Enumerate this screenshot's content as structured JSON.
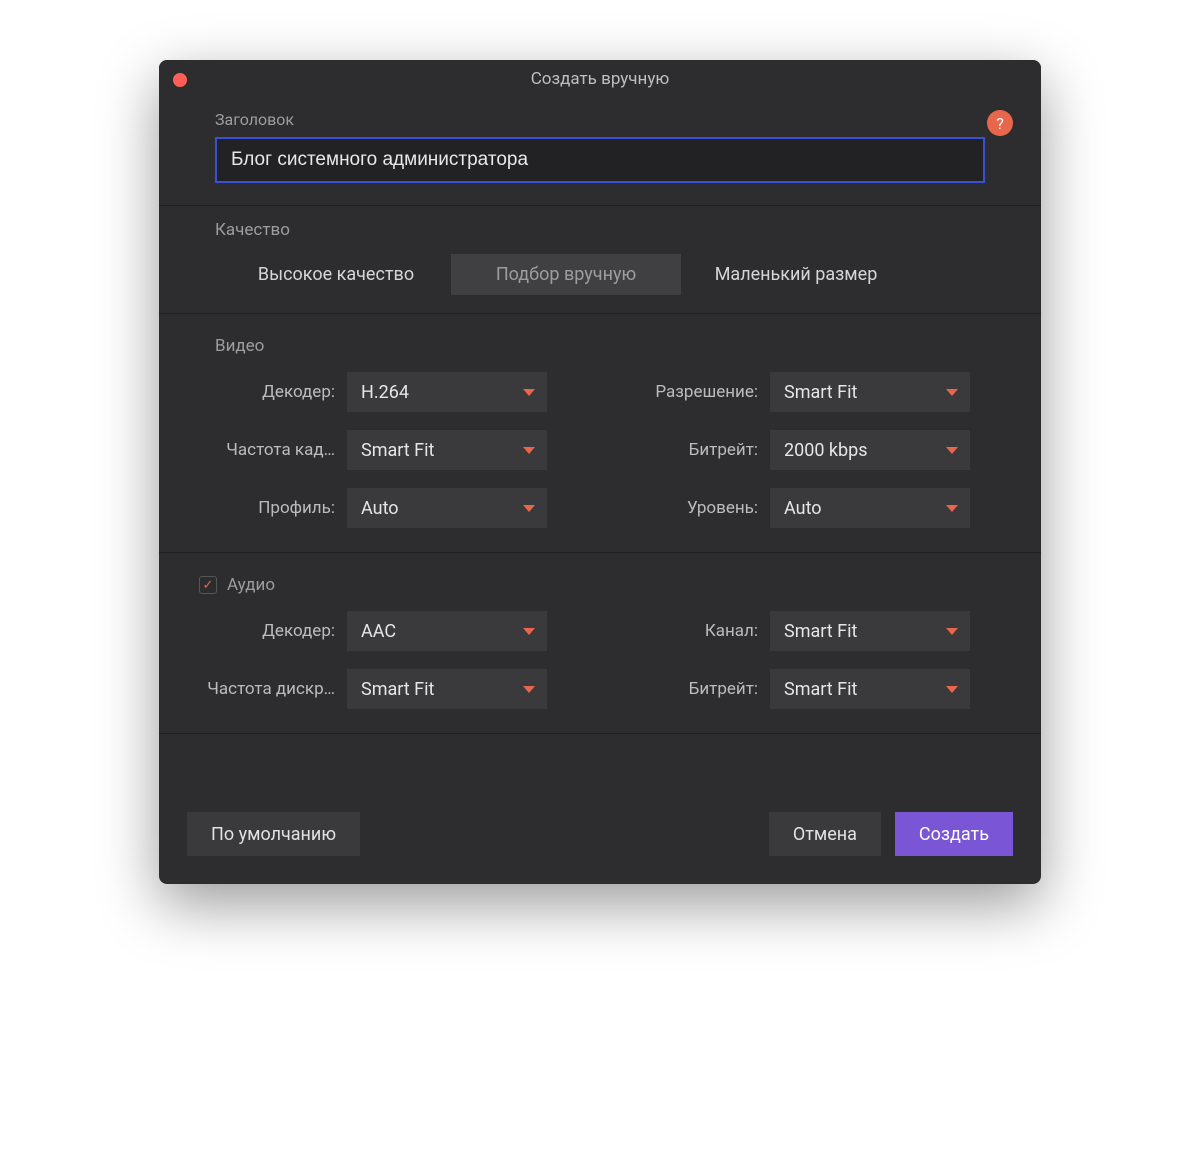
{
  "window": {
    "title": "Создать вручную"
  },
  "header": {
    "label": "Заголовок",
    "title_value": "Блог системного администратора",
    "help_icon": "?"
  },
  "quality": {
    "label": "Качество",
    "options": [
      "Высокое качество",
      "Подбор вручную",
      "Маленький размер"
    ],
    "selected_index": 1
  },
  "video": {
    "label": "Видео",
    "fields": {
      "decoder": {
        "label": "Декодер:",
        "value": "H.264"
      },
      "resolution": {
        "label": "Разрешение:",
        "value": "Smart Fit"
      },
      "framerate": {
        "label": "Частота кад…",
        "value": "Smart Fit"
      },
      "bitrate": {
        "label": "Битрейт:",
        "value": "2000 kbps"
      },
      "profile": {
        "label": "Профиль:",
        "value": "Auto"
      },
      "level": {
        "label": "Уровень:",
        "value": "Auto"
      }
    }
  },
  "audio": {
    "label": "Аудио",
    "enabled": true,
    "fields": {
      "decoder": {
        "label": "Декодер:",
        "value": "AAC"
      },
      "channel": {
        "label": "Канал:",
        "value": "Smart Fit"
      },
      "samplerate": {
        "label": "Частота дискр…",
        "value": "Smart Fit"
      },
      "bitrate": {
        "label": "Битрейт:",
        "value": "Smart Fit"
      }
    }
  },
  "footer": {
    "default": "По умолчанию",
    "cancel": "Отмена",
    "create": "Создать"
  },
  "colors": {
    "accent": "#7a55d6",
    "highlight": "#e8674c",
    "focus_border": "#3a4fd6"
  }
}
